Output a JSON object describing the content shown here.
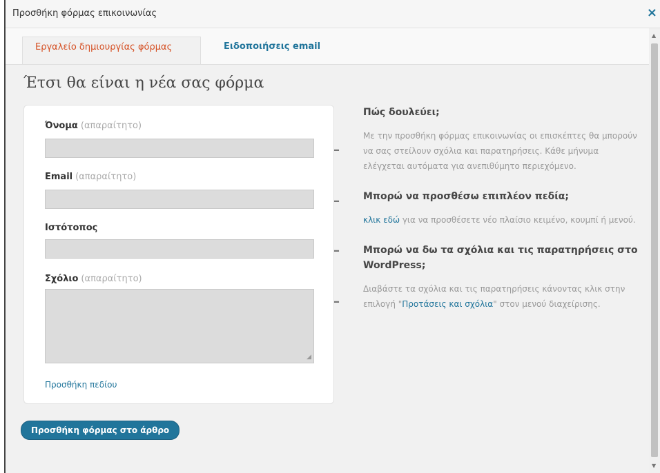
{
  "dialog": {
    "title": "Προσθήκη φόρμας επικοινωνίας",
    "close_label": "×"
  },
  "tabs": [
    {
      "label": "Εργαλείο δημιουργίας φόρμας",
      "active": true
    },
    {
      "label": "Ειδοποιήσεις email",
      "active": false
    }
  ],
  "main": {
    "heading": "Έτσι θα είναι η νέα σας φόρμα"
  },
  "form": {
    "fields": [
      {
        "label": "Όνομα",
        "required_note": "(απαραίτητο)"
      },
      {
        "label": "Email",
        "required_note": "(απαραίτητο)"
      },
      {
        "label": "Ιστότοπος",
        "required_note": ""
      },
      {
        "label": "Σχόλιο",
        "required_note": "(απαραίτητο)"
      }
    ],
    "remove_label": "–",
    "add_field": "Προσθήκη πεδίου"
  },
  "help": {
    "h1": "Πώς δουλεύει;",
    "p1": "Με την προσθήκη φόρμας επικοινωνίας οι επισκέπτες θα μπορούν να σας στείλουν σχόλια και παρατηρήσεις. Κάθε μήνυμα ελέγχεται αυτόματα για ανεπιθύμητο περιεχόμενο.",
    "h2": "Μπορώ να προσθέσω επιπλέον πεδία;",
    "p2_link": "κλικ εδώ",
    "p2_rest": " για να προσθέσετε νέο πλαίσιο κειμένο, κουμπί ή μενού.",
    "h3": "Μπορώ να δω τα σχόλια και τις παρατηρήσεις στο WordPress;",
    "p3_before": "Διαβάστε τα σχόλια και τις παρατηρήσεις κάνοντας κλικ στην επιλογή \"",
    "p3_link": "Προτάσεις και σχόλια",
    "p3_after": "\" στον μενού διαχείρισης."
  },
  "submit_label": "Προσθήκη φόρμας στο άρθρο",
  "colors": {
    "accent": "#21759b",
    "active_tab": "#d54e21"
  }
}
